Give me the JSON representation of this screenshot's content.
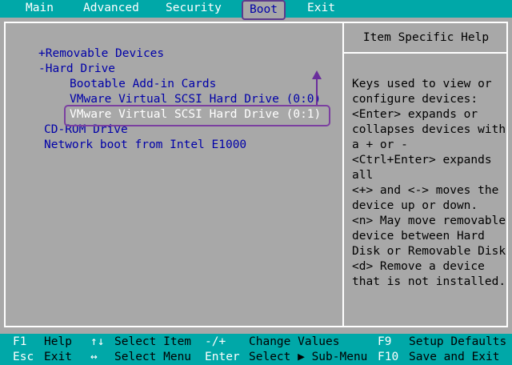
{
  "menu": {
    "items": [
      "Main",
      "Advanced",
      "Security",
      "Boot",
      "Exit"
    ],
    "active_index": 3
  },
  "boot_list": {
    "items": [
      "+Removable Devices",
      "-Hard Drive",
      "Bootable Add-in Cards",
      "VMware Virtual SCSI Hard Drive (0:0)",
      "VMware Virtual SCSI Hard Drive (0:1)",
      "CD-ROM Drive",
      "Network boot from Intel E1000"
    ],
    "selected_index": 4
  },
  "help": {
    "title": "Item Specific Help",
    "lines": [
      "Keys used to view or",
      "configure devices:",
      "<Enter> expands or",
      "collapses devices with",
      "a + or -",
      "<Ctrl+Enter> expands",
      "all",
      "<+> and <-> moves the",
      "device up or down.",
      "<n> May move removable",
      "device between Hard",
      "Disk or Removable Disk",
      "<d> Remove a device",
      "that is not installed."
    ]
  },
  "footer": {
    "row1": [
      {
        "key": "F1",
        "desc": "Help"
      },
      {
        "key": "↑↓",
        "desc": "Select Item"
      },
      {
        "key": "-/+",
        "desc": "Change Values"
      },
      {
        "key": "F9",
        "desc": "Setup Defaults"
      }
    ],
    "row2": [
      {
        "key": "Esc",
        "desc": "Exit"
      },
      {
        "key": "↔",
        "desc": "Select Menu"
      },
      {
        "key": "Enter",
        "desc": "Select ▶ Sub-Menu"
      },
      {
        "key": "F10",
        "desc": "Save and Exit"
      }
    ]
  },
  "colors": {
    "background": "#a8a8a8",
    "bar": "#00a8a8",
    "item_text": "#0000a8",
    "selected_text": "#ffffff",
    "annotation": "#6a2d9c"
  }
}
